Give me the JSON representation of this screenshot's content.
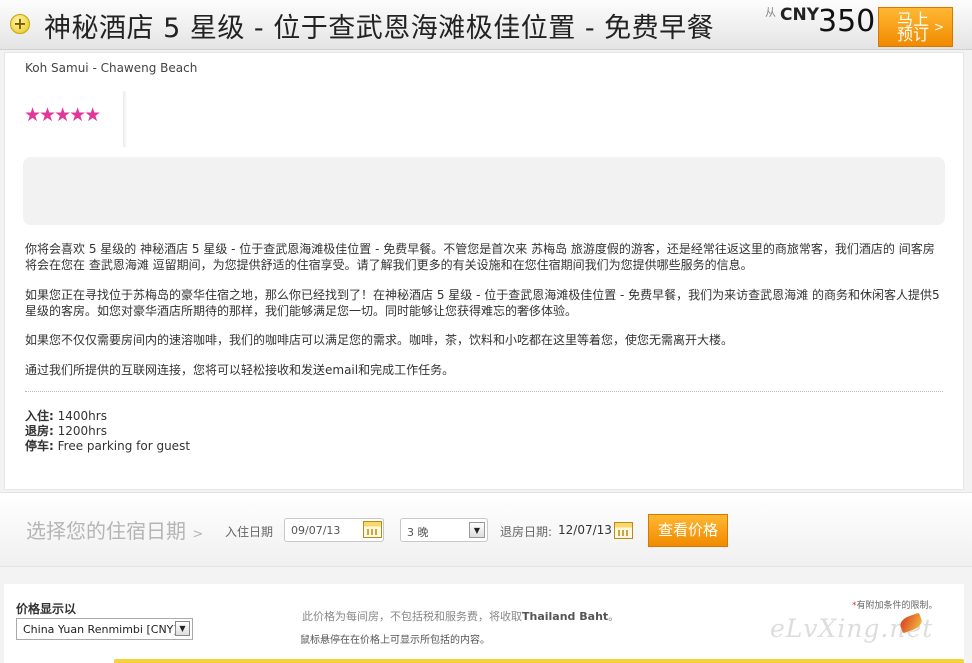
{
  "header": {
    "title": "神秘酒店 5 星级 - 位于查武恩海滩极佳位置 - 免费早餐",
    "from_label": "从",
    "currency": "CNY",
    "price": "350",
    "book_label_line1": "马上",
    "book_label_line2": "预订",
    "book_chevron": ">"
  },
  "hotel": {
    "location": "Koh Samui - Chaweng Beach",
    "stars": "★★★★★",
    "star_rating": 5,
    "star_color": "#e0389a"
  },
  "description": [
    "你将会喜欢 5 星级的 神秘酒店 5 星级 - 位于查武恩海滩极佳位置 - 免费早餐。不管您是首次来 苏梅岛 旅游度假的游客，还是经常往返这里的商旅常客，我们酒店的 间客房将会在您在 查武恩海滩 逗留期间，为您提供舒适的住宿享受。请了解我们更多的有关设施和在您住宿期间我们为您提供哪些服务的信息。",
    "如果您正在寻找位于苏梅岛的豪华住宿之地，那么你已经找到了！在神秘酒店 5 星级 - 位于查武恩海滩极佳位置 - 免费早餐，我们为来访查武恩海滩 的商务和休闲客人提供5星级的客房。如您对豪华酒店所期待的那样，我们能够满足您一切。同时能够让您获得难忘的奢侈体验。",
    "如果您不仅仅需要房间内的速溶咖啡，我们的咖啡店可以满足您的需求。咖啡，茶，饮料和小吃都在这里等着您，使您无需离开大楼。",
    "通过我们所提供的互联网连接，您将可以轻松接收和发送email和完成工作任务。"
  ],
  "info": {
    "checkin_label": "入住:",
    "checkin_value": "1400hrs",
    "checkout_label": "退房:",
    "checkout_value": "1200hrs",
    "parking_label": "停车:",
    "parking_value": "Free parking for guest"
  },
  "date_bar": {
    "title": "选择您的住宿日期",
    "title_chevron": ">",
    "checkin_label": "入住日期",
    "checkin_date": "09/07/13",
    "nights": "3 晚",
    "checkout_label": "退房日期:",
    "checkout_date": "12/07/13",
    "check_price_label": "查看价格"
  },
  "bottom": {
    "price_display_label": "价格显示以",
    "currency_option": "China Yuan Renmimbi [CNY]",
    "price_note_prefix": "此价格为每间房，不包括税和服务费，将收取",
    "price_note_currency": "Thailand Baht",
    "price_note_suffix": "。",
    "hover_note": "鼠标悬停在在价格上可显示所包括的内容。",
    "conditions_asterisk": "*",
    "conditions": "有附加条件的限制。",
    "watermark": "eLvXing.net"
  },
  "colors": {
    "accent_orange": "#f39a11",
    "star_pink": "#e0389a"
  }
}
